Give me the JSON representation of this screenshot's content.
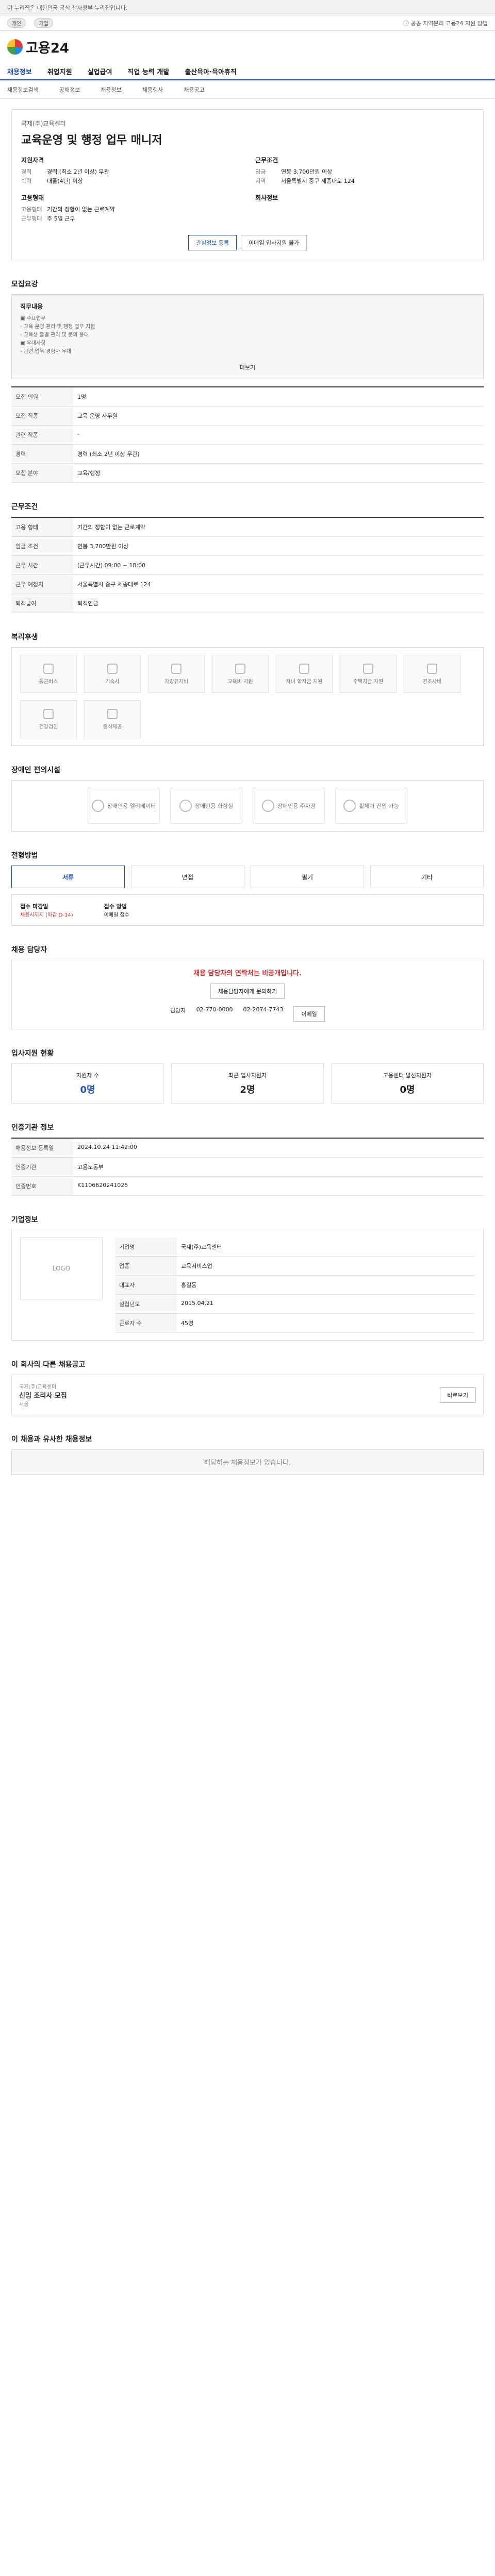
{
  "topbar": {
    "notice": "이 누리집은 대한민국 공식 전자정부 누리집입니다.",
    "tabs": [
      "개인",
      "기업"
    ],
    "right": "ⓘ 공공 지역분리 고용24 지원 방법"
  },
  "header": {
    "logo_text": "고용24"
  },
  "nav": [
    "채용정보",
    "취업지원",
    "실업급여",
    "직업 능력 개발",
    "출산육아·육아휴직"
  ],
  "subnav": [
    "채용정보검색",
    "공채정보",
    "채용정보",
    "채용행사",
    "채용공고"
  ],
  "job": {
    "company": "국제(주)교육센터",
    "title": "교육운영 및 행정 업무 매니저",
    "left_group": {
      "heading": "지원자격",
      "rows": [
        {
          "k": "경력",
          "v": "경력 (최소 2년 이상) 무관"
        },
        {
          "k": "학력",
          "v": "대졸(4년) 이상"
        }
      ]
    },
    "right_group": {
      "heading": "근무조건",
      "rows": [
        {
          "k": "임금",
          "v": "연봉 3,700만원 이상"
        },
        {
          "k": "지역",
          "v": "서울특별시 중구 세종대로 124"
        }
      ]
    },
    "left_group2": {
      "heading": "고용형태",
      "rows": [
        {
          "k": "고용형태",
          "v": "기간의 정함이 없는 근로계약"
        },
        {
          "k": "근무형태",
          "v": "주 5일 근무"
        }
      ]
    },
    "right_group2": {
      "heading": "회사정보",
      "rows": [
        {
          "k": "",
          "v": ""
        }
      ]
    },
    "buttons": [
      "관심정보 등록",
      "이메일 입사지원 불가"
    ]
  },
  "sections": {
    "recruit_title": "모집요강",
    "work_title": "근무조건",
    "welfare_title": "복리후생",
    "disabled_title": "장애인 편의시설",
    "process_title": "전형방법",
    "contact_title": "채용 담당자",
    "status_title": "입사지원 현황",
    "org_title": "인증기관 정보",
    "company_title": "기업정보",
    "other_title": "이 회사의 다른 채용공고",
    "rec_title": "이 채용과 유사한 채용정보"
  },
  "recruit": {
    "box_title": "직무내용",
    "lines": [
      "▣ 주요업무",
      " - 교육 운영 관리 및 행정 업무 지원",
      " - 교육생 출결 관리 및 문의 응대",
      "▣ 우대사항",
      " - 관련 업무 경험자 우대"
    ],
    "more": "더보기",
    "rows": [
      {
        "k": "모집 인원",
        "v": "1명"
      },
      {
        "k": "모집 직종",
        "v": "교육 운영 사무원"
      },
      {
        "k": "관련 직종",
        "v": "-"
      },
      {
        "k": "경력",
        "v": "경력 (최소 2년 이상 무관)"
      },
      {
        "k": "모집 분야",
        "v": "교육/행정"
      }
    ]
  },
  "work": {
    "rows": [
      {
        "k": "고용 형태",
        "v": "기간의 정함이 없는 근로계약"
      },
      {
        "k": "임금 조건",
        "v": "연봉 3,700만원 이상"
      },
      {
        "k": "근무 시간",
        "v": "(근무시간) 09:00 ~ 18:00"
      },
      {
        "k": "근무 예정지",
        "v": "서울특별시 중구 세종대로 124"
      },
      {
        "k": "퇴직급여",
        "v": "퇴직연금"
      }
    ]
  },
  "welfare": {
    "items": [
      "통근버스",
      "기숙사",
      "차량유지비",
      "교육비 지원",
      "자녀 학자금 지원",
      "주택자금 지원",
      "경조사비",
      "건강검진",
      "중식제공"
    ]
  },
  "disabled": {
    "items": [
      "장애인용 엘리베이터",
      "장애인용 화장실",
      "장애인용 주차장",
      "휠체어 진입 가능"
    ]
  },
  "process": {
    "steps": [
      "서류",
      "면접",
      "필기",
      "기타"
    ],
    "deadline_label": "접수 마감일",
    "deadline": "채용시까지 (마감 D-14)",
    "method_label": "접수 방법",
    "method": "이메일 접수"
  },
  "contact": {
    "notice": "채용 담당자의 연락처는 비공개입니다.",
    "button": "채용담당자에게 문의하기",
    "name": "담당자",
    "phone": "02-770-0000",
    "fax": "02-2074-7743",
    "email": "이메일"
  },
  "status": {
    "applicants": "0명",
    "viewed": "2명",
    "recent": "0명",
    "labels": [
      "지원자 수",
      "최근 입사지원자",
      "고용센터 알선지원자"
    ]
  },
  "org": {
    "rows": [
      {
        "k": "채용정보 등록일",
        "v": "2024.10.24 11:42:00"
      },
      {
        "k": "인증기관",
        "v": "고용노동부"
      },
      {
        "k": "인증번호",
        "v": "K1106620241025"
      }
    ]
  },
  "company": {
    "logo": "LOGO",
    "rows": [
      {
        "k": "기업명",
        "v": "국제(주)교육센터"
      },
      {
        "k": "업종",
        "v": "교육서비스업"
      },
      {
        "k": "대표자",
        "v": "홍길동"
      },
      {
        "k": "설립년도",
        "v": "2015.04.21"
      },
      {
        "k": "근로자 수",
        "v": "45명"
      }
    ]
  },
  "other": {
    "title": "신입 조리사 모집",
    "company": "국제(주)교육센터",
    "loc": "서울",
    "button": "바로보기"
  },
  "rec": {
    "empty": "해당하는 채용정보가 없습니다."
  }
}
